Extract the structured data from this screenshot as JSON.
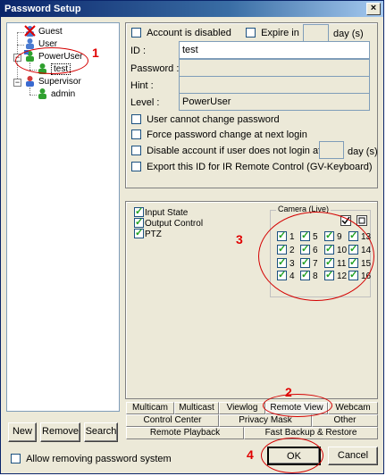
{
  "window": {
    "title": "Password Setup",
    "close_glyph": "×"
  },
  "tree": {
    "nodes": [
      {
        "label": "Guest",
        "icon": "user-red-x-icon"
      },
      {
        "label": "User",
        "icon": "user-blue-icon"
      },
      {
        "label": "PowerUser",
        "icon": "user-green-icon"
      },
      {
        "label": "test",
        "icon": "user-green-icon"
      },
      {
        "label": "Supervisor",
        "icon": "user-red-icon"
      },
      {
        "label": "admin",
        "icon": "user-green-icon"
      }
    ],
    "expand_glyph": "−"
  },
  "left_buttons": {
    "new": "New",
    "remove": "Remove",
    "search": "Search"
  },
  "allow_removing": {
    "label": "Allow removing password system",
    "checked": false
  },
  "account": {
    "disabled_label": "Account is disabled",
    "expire_label": "Expire in",
    "expire_unit": "day (s)",
    "id_label": "ID :",
    "id_value": "test",
    "password_label": "Password :",
    "hint_label": "Hint :",
    "level_label": "Level :",
    "level_value": "PowerUser",
    "options": [
      "User cannot change password",
      "Force password change at next login",
      "Disable account if user does not login after",
      "Export this ID for IR Remote Control (GV-Keyboard)"
    ],
    "disable_unit": "day (s)"
  },
  "permissions": {
    "items": [
      {
        "label": "Input State",
        "checked": true
      },
      {
        "label": "Output Control",
        "checked": true
      },
      {
        "label": "PTZ",
        "checked": true
      }
    ],
    "camera_group_label": "Camera (Live)",
    "cameras": [
      "1",
      "5",
      "9",
      "13",
      "2",
      "6",
      "10",
      "14",
      "3",
      "7",
      "11",
      "15",
      "4",
      "8",
      "12",
      "16"
    ]
  },
  "tabs": {
    "row1": [
      "Multicam",
      "Multicast",
      "Viewlog",
      "Remote View",
      "Webcam"
    ],
    "row2": [
      "Control Center",
      "Privacy Mask",
      "Other"
    ],
    "row3": [
      "Remote Playback",
      "Fast Backup & Restore"
    ],
    "active": "Remote View"
  },
  "footer": {
    "ok": "OK",
    "cancel": "Cancel"
  },
  "annotations": [
    "1",
    "2",
    "3",
    "4"
  ],
  "colors": {
    "annotation": "#e00000",
    "title_bar": "#0a246a",
    "face": "#ece9d8"
  }
}
